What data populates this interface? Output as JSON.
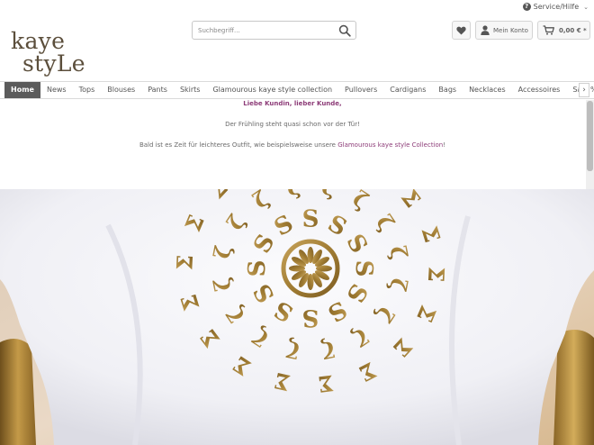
{
  "header": {
    "service_label": "Service/Hilfe",
    "logo_line1": "kaye",
    "logo_line2": "styLe",
    "search_placeholder": "Suchbegriff...",
    "account_label": "Mein Konto",
    "cart_amount": "0,00 € *"
  },
  "nav": {
    "items": [
      {
        "label": "Home",
        "active": true
      },
      {
        "label": "News"
      },
      {
        "label": "Tops"
      },
      {
        "label": "Blouses"
      },
      {
        "label": "Pants"
      },
      {
        "label": "Skirts"
      },
      {
        "label": "Glamourous kaye style collection"
      },
      {
        "label": "Pullovers"
      },
      {
        "label": "Cardigans"
      },
      {
        "label": "Bags"
      },
      {
        "label": "Necklaces"
      },
      {
        "label": "Accessoires"
      },
      {
        "label": "Sale %"
      }
    ],
    "scroll_arrow": "›"
  },
  "notice": {
    "greeting": "Liebe Kundin, lieber Kunde,",
    "line1": "Der Frühling steht quasi schon vor der Tür!",
    "line2_prefix": "Bald ist es Zeit für leichteres Outfit, wie beispielsweise unsere ",
    "line2_link": "Glamourous kaye style Collection",
    "line2_suffix": "!"
  },
  "icons": {
    "service": "question-circle-icon",
    "search": "search-icon",
    "wishlist": "heart-icon",
    "account": "user-icon",
    "cart": "cart-icon"
  },
  "colors": {
    "accent": "#8d3c78",
    "nav_active": "#5b5b5b",
    "logo": "#5b4e3b",
    "gold": "#b08a3e"
  }
}
